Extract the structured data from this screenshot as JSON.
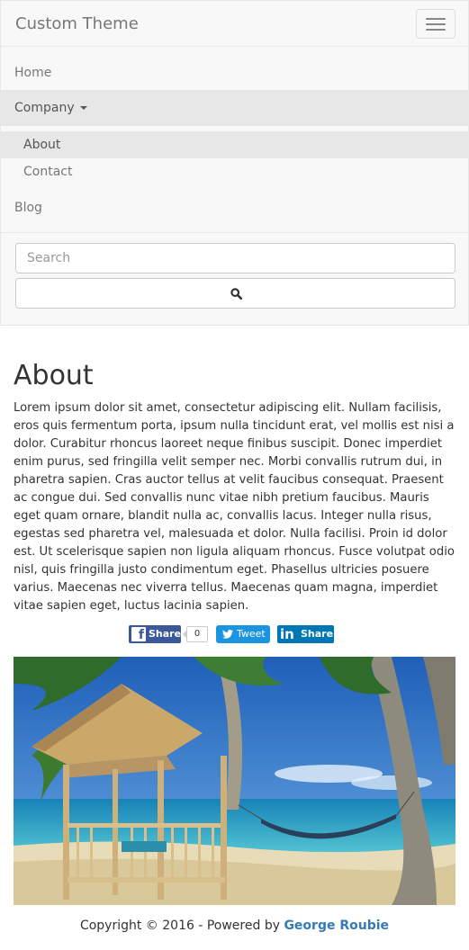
{
  "navbar": {
    "brand": "Custom Theme",
    "items": [
      {
        "label": "Home"
      },
      {
        "label": "Company"
      },
      {
        "label": "Blog"
      }
    ],
    "dropdown": [
      {
        "label": "About"
      },
      {
        "label": "Contact"
      }
    ],
    "search": {
      "placeholder": "Search"
    },
    "icons": {
      "toggle": "hamburger-icon",
      "search": "search-icon",
      "dropdown": "caret-down-icon"
    }
  },
  "page": {
    "title": "About",
    "body": "Lorem ipsum dolor sit amet, consectetur adipiscing elit. Nullam facilisis, eros quis fermentum porta, ipsum nulla tincidunt erat, vel mollis est nisi a dolor. Curabitur rhoncus laoreet neque finibus suscipit. Donec imperdiet enim purus, sed fringilla velit semper nec. Morbi convallis rutrum dui, in pharetra sapien. Cras auctor tellus at velit faucibus consequat. Praesent ac congue dui. Sed convallis nunc vitae nibh pretium faucibus. Mauris eget quam ornare, blandit nulla ac, convallis lacus. Integer nulla risus, egestas sed pharetra vel, malesuada et dolor. Nulla facilisi. Proin id dolor est. Ut scelerisque sapien non ligula aliquam rhoncus. Fusce volutpat odio nisl, quis fringilla justo condimentum eget. Phasellus ultricies posuere varius. Maecenas nec viverra tellus. Maecenas quam magna, imperdiet vitae sapien eget, luctus lacinia sapien."
  },
  "share": {
    "facebook": {
      "label": "Share",
      "count": "0",
      "color": "#3b5998"
    },
    "twitter": {
      "label": "Tweet",
      "color": "#1b95e0"
    },
    "linkedin": {
      "label": "Share",
      "color": "#0077b5"
    }
  },
  "footer": {
    "text": "Copyright © 2016 - Powered by ",
    "author": "George Roubie"
  },
  "colors": {
    "link": "#337ab7",
    "navbar_bg": "#f8f8f8",
    "active_bg": "#e7e7e7"
  }
}
